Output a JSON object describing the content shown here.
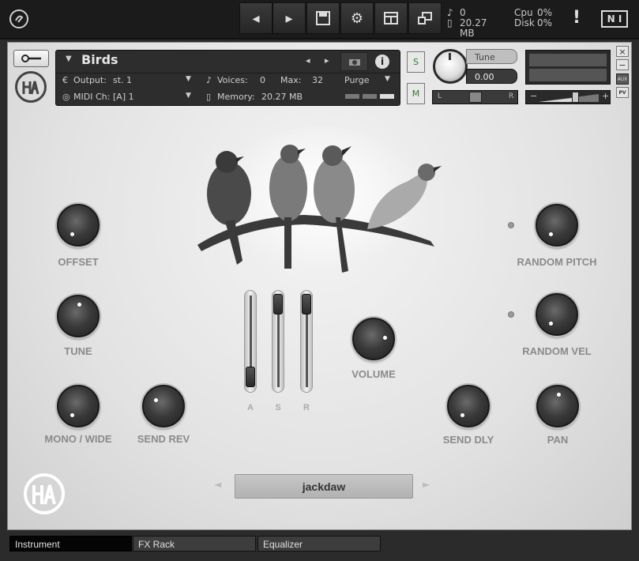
{
  "topbar": {
    "voices_label": "0",
    "memory_label": "20.27 MB",
    "cpu_label": "Cpu",
    "cpu_value": "0%",
    "disk_label": "Disk",
    "disk_value": "0%",
    "warning": "!",
    "brand": "N I"
  },
  "instrument_header": {
    "name": "Birds",
    "output_label": "Output:",
    "output_value": "st. 1",
    "voices_label": "Voices:",
    "voices_value": "0",
    "max_label": "Max:",
    "max_value": "32",
    "purge_label": "Purge",
    "midi_label": "MIDI Ch:",
    "midi_value": "[A] 1",
    "memory_label": "Memory:",
    "memory_value": "20.27 MB",
    "solo_label": "S",
    "mute_label": "M",
    "tune_label": "Tune",
    "tune_value": "0.00",
    "pan_left": "L",
    "pan_right": "R",
    "close_label": "×",
    "minimize_label": "−",
    "aux_label": "AUX",
    "pv_label": "PV",
    "vol_minus": "−",
    "vol_plus": "+"
  },
  "knobs": {
    "offset": "OFFSET",
    "tune": "TUNE",
    "mono_wide": "MONO / WIDE",
    "send_rev": "SEND REV",
    "volume": "VOLUME",
    "random_pitch": "RANDOM PITCH",
    "random_vel": "RANDOM VEL",
    "send_dly": "SEND DLY",
    "pan": "PAN"
  },
  "envelope": {
    "attack": "A",
    "sustain": "S",
    "release": "R",
    "attack_level": 0.1,
    "sustain_level": 1.0,
    "release_level": 1.0
  },
  "preset": {
    "value": "jackdaw",
    "prev": "◄",
    "next": "►"
  },
  "tabs": [
    "Instrument",
    "FX Rack",
    "Equalizer"
  ],
  "colors": {
    "panel": "#e6e6e6",
    "knob": "#2e2e2e",
    "label": "#8a8a8a",
    "topbar": "#1b1b1b"
  }
}
